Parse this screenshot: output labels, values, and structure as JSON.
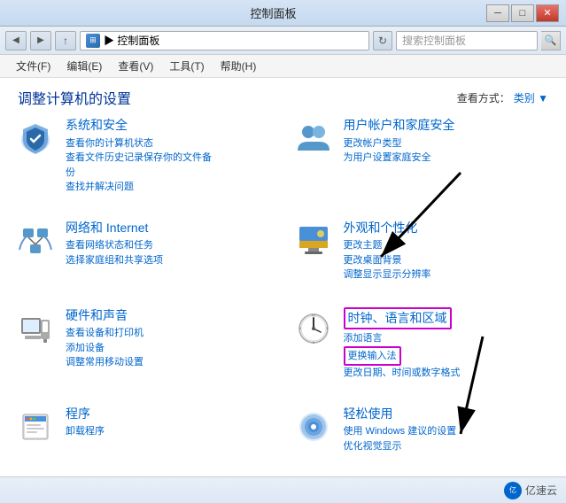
{
  "titleBar": {
    "title": "控制面板",
    "minBtn": "─",
    "maxBtn": "□",
    "closeBtn": "✕"
  },
  "navBar": {
    "backBtn": "◀",
    "forwardBtn": "▶",
    "upBtn": "↑",
    "homeIcon": "⊞",
    "addressPath": "▶ 控制面板",
    "refreshBtn": "↻",
    "searchPlaceholder": "搜索控制面板",
    "searchBtn": "🔍"
  },
  "menuBar": {
    "items": [
      {
        "label": "文件(F)"
      },
      {
        "label": "编辑(E)"
      },
      {
        "label": "查看(V)"
      },
      {
        "label": "工具(T)"
      },
      {
        "label": "帮助(H)"
      }
    ]
  },
  "contentHeader": {
    "title": "调整计算机的设置",
    "viewLabel": "查看方式：",
    "viewValue": "类别 ▼"
  },
  "categories": [
    {
      "id": "system-security",
      "title": "系统和安全",
      "links": [
        "查看你的计算机状态",
        "查看文件历史记录保存你的文件备份",
        "查找并解决问题"
      ],
      "iconType": "shield"
    },
    {
      "id": "user-accounts",
      "title": "用户帐户和家庭安全",
      "links": [
        "更改帐户类型",
        "为用户设置家庭安全"
      ],
      "iconType": "users"
    },
    {
      "id": "network",
      "title": "网络和 Internet",
      "links": [
        "查看网络状态和任务",
        "选择家庭组和共享选项"
      ],
      "iconType": "network"
    },
    {
      "id": "appearance",
      "title": "外观和个性化",
      "links": [
        "更改主题",
        "更改桌面背景",
        "调整显示显示分辨率"
      ],
      "iconType": "appearance"
    },
    {
      "id": "hardware",
      "title": "硬件和声音",
      "links": [
        "查看设备和打印机",
        "添加设备",
        "调整常用移动设置"
      ],
      "iconType": "hardware"
    },
    {
      "id": "clock",
      "title": "时钟、语言和区域",
      "links": [
        "添加语言",
        "更换输入法",
        "更改日期、时间或数字格式"
      ],
      "iconType": "clock",
      "highlighted": true
    },
    {
      "id": "programs",
      "title": "程序",
      "links": [
        "卸载程序"
      ],
      "iconType": "programs"
    },
    {
      "id": "ease",
      "title": "轻松使用",
      "links": [
        "使用 Windows 建议的设置",
        "优化视觉显示"
      ],
      "iconType": "ease"
    }
  ],
  "statusBar": {
    "watermark": "亿速云"
  }
}
